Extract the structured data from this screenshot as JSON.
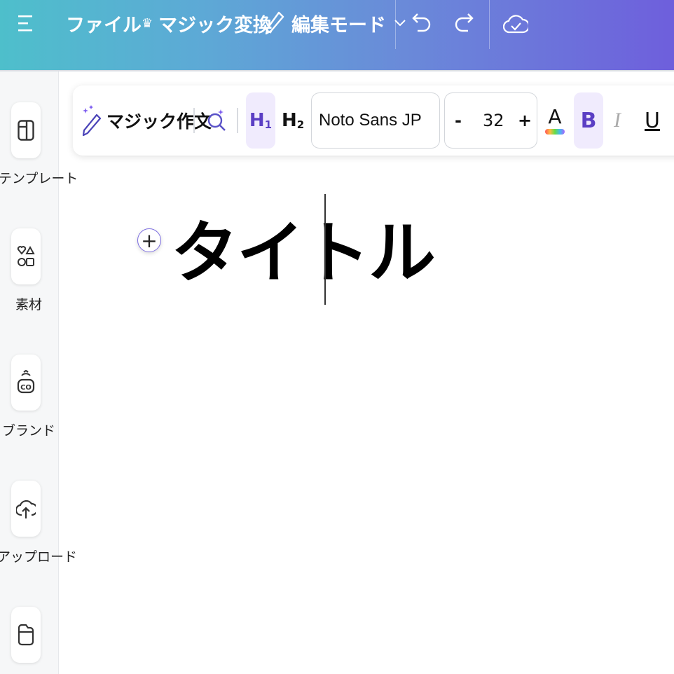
{
  "topbar": {
    "menu_icon": "hamburger-menu-icon",
    "file_label": "ファイル",
    "magic_convert_label": "マジック変換",
    "edit_mode_label": "編集モード",
    "undo_icon": "undo-icon",
    "redo_icon": "redo-icon",
    "cloud_icon": "cloud-check-icon"
  },
  "sidebar": {
    "items": [
      {
        "label": "テンプレート",
        "icon": "template-icon"
      },
      {
        "label": "素材",
        "icon": "elements-icon"
      },
      {
        "label": "ブランド",
        "icon": "brand-icon"
      },
      {
        "label": "アップロード",
        "icon": "upload-icon"
      },
      {
        "label": "",
        "icon": "folder-icon"
      }
    ]
  },
  "toolbar": {
    "magic_write_label": "マジック作文",
    "h1_label": "H",
    "h1_sub": "1",
    "h2_label": "H",
    "h2_sub": "2",
    "font_name": "Noto Sans JP",
    "decrease_label": "-",
    "font_size": "32",
    "increase_label": "+",
    "text_color_label": "A",
    "bold_label": "B",
    "italic_label": "I",
    "underline_label": "U"
  },
  "canvas": {
    "title_text": "タイトル",
    "add_label": "+"
  },
  "colors": {
    "accent": "#5b3fc4",
    "active_bg": "#f0ebfd",
    "gradient_start": "#4ebfcb",
    "gradient_end": "#6e5fdc"
  }
}
